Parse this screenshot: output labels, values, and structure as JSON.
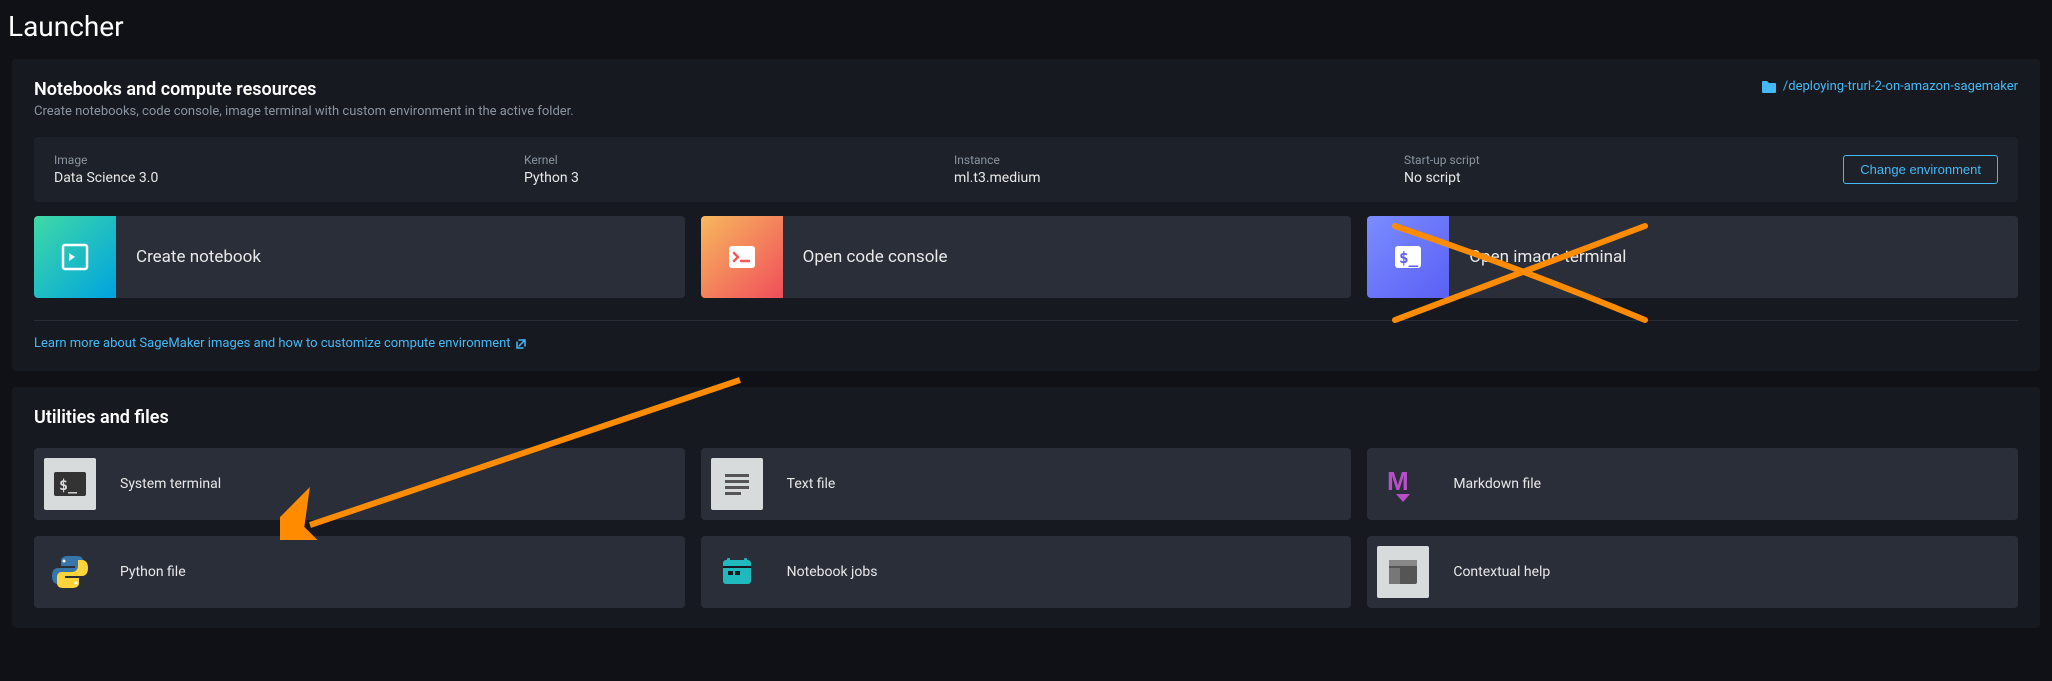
{
  "page_title": "Launcher",
  "notebooks_section": {
    "title": "Notebooks and compute resources",
    "subtitle": "Create notebooks, code console, image terminal with custom environment in the active folder.",
    "folder_path": "/deploying-trurl-2-on-amazon-sagemaker",
    "env": {
      "image_label": "Image",
      "image_value": "Data Science 3.0",
      "kernel_label": "Kernel",
      "kernel_value": "Python 3",
      "instance_label": "Instance",
      "instance_value": "ml.t3.medium",
      "script_label": "Start-up script",
      "script_value": "No script",
      "change_button": "Change environment"
    },
    "cards": {
      "create_notebook": "Create notebook",
      "open_console": "Open code console",
      "open_terminal": "Open image terminal"
    },
    "learn_more": "Learn more about SageMaker images and how to customize compute environment"
  },
  "utilities_section": {
    "title": "Utilities and files",
    "items": {
      "system_terminal": "System terminal",
      "text_file": "Text file",
      "markdown_file": "Markdown file",
      "python_file": "Python file",
      "notebook_jobs": "Notebook jobs",
      "contextual_help": "Contextual help"
    }
  }
}
